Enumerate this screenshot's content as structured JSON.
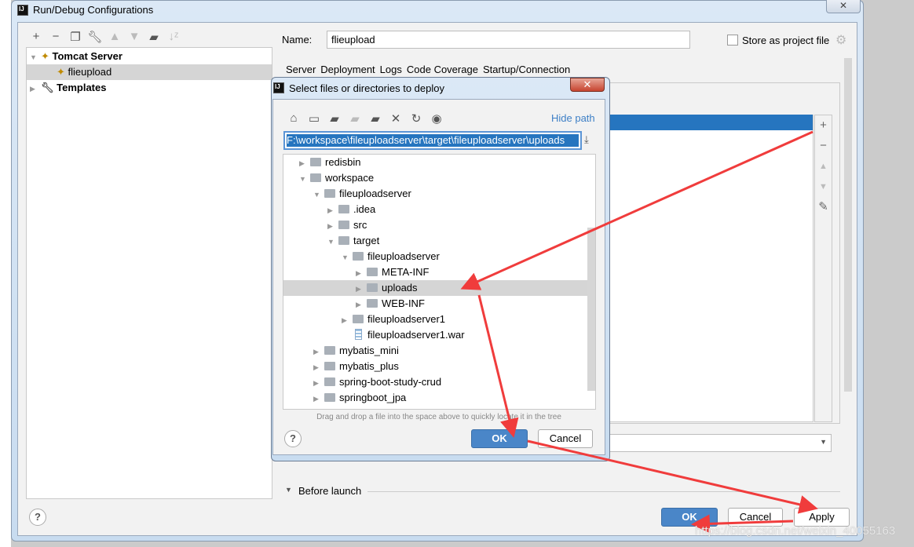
{
  "window": {
    "title": "Run/Debug Configurations",
    "close": "✕"
  },
  "left_toolbar": [
    "add-icon",
    "remove-icon",
    "copy-icon",
    "wrench-icon",
    "move-up-icon",
    "move-down-icon",
    "new-folder-icon",
    "sort-icon"
  ],
  "tree": {
    "items": [
      {
        "label": "Tomcat Server",
        "expanded": true
      },
      {
        "label": "flieupload",
        "selected": true
      },
      {
        "label": "Templates",
        "expanded": false
      }
    ]
  },
  "name_label": "Name:",
  "name_value": "flieupload",
  "store_label": "Store as project file",
  "store_checked": false,
  "tabs": [
    "Server",
    "Deployment",
    "Logs",
    "Code Coverage",
    "Startup/Connection"
  ],
  "before_launch": "Before launch",
  "buttons": {
    "ok": "OK",
    "cancel": "Cancel",
    "apply": "Apply",
    "help": "?"
  },
  "chooser": {
    "title": "Select files or directories to deploy",
    "close": "✕",
    "hide_path": "Hide path",
    "path": "F:\\workspace\\fileuploadserver\\target\\fileuploadserver\\uploads",
    "rows": [
      {
        "label": "redisbin",
        "depth": 1,
        "arrow": "▶",
        "type": "folder"
      },
      {
        "label": "workspace",
        "depth": 1,
        "arrow": "▼",
        "type": "folder"
      },
      {
        "label": "fileuploadserver",
        "depth": 2,
        "arrow": "▼",
        "type": "folder"
      },
      {
        "label": ".idea",
        "depth": 3,
        "arrow": "▶",
        "type": "folder"
      },
      {
        "label": "src",
        "depth": 3,
        "arrow": "▶",
        "type": "folder"
      },
      {
        "label": "target",
        "depth": 3,
        "arrow": "▼",
        "type": "folder"
      },
      {
        "label": "fileuploadserver",
        "depth": 4,
        "arrow": "▼",
        "type": "folder"
      },
      {
        "label": "META-INF",
        "depth": 5,
        "arrow": "▶",
        "type": "folder"
      },
      {
        "label": "uploads",
        "depth": 5,
        "arrow": "▶",
        "type": "folder",
        "selected": true
      },
      {
        "label": "WEB-INF",
        "depth": 5,
        "arrow": "▶",
        "type": "folder"
      },
      {
        "label": "fileuploadserver1",
        "depth": 4,
        "arrow": "▶",
        "type": "folder"
      },
      {
        "label": "fileuploadserver1.war",
        "depth": 4,
        "arrow": "",
        "type": "war"
      },
      {
        "label": "mybatis_mini",
        "depth": 2,
        "arrow": "▶",
        "type": "folder"
      },
      {
        "label": "mybatis_plus",
        "depth": 2,
        "arrow": "▶",
        "type": "folder"
      },
      {
        "label": "spring-boot-study-crud",
        "depth": 2,
        "arrow": "▶",
        "type": "folder"
      },
      {
        "label": "springboot_jpa",
        "depth": 2,
        "arrow": "▶",
        "type": "folder"
      }
    ],
    "hint": "Drag and drop a file into the space above to quickly locate it in the tree",
    "ok": "OK",
    "cancel": "Cancel",
    "help": "?"
  },
  "watermark": "https://blog.csdn.net/weixin_40055163",
  "colors": {
    "selection": "#2675bf",
    "annotation_arrow": "#f03c3c",
    "ok_button": "#4a86c8"
  }
}
